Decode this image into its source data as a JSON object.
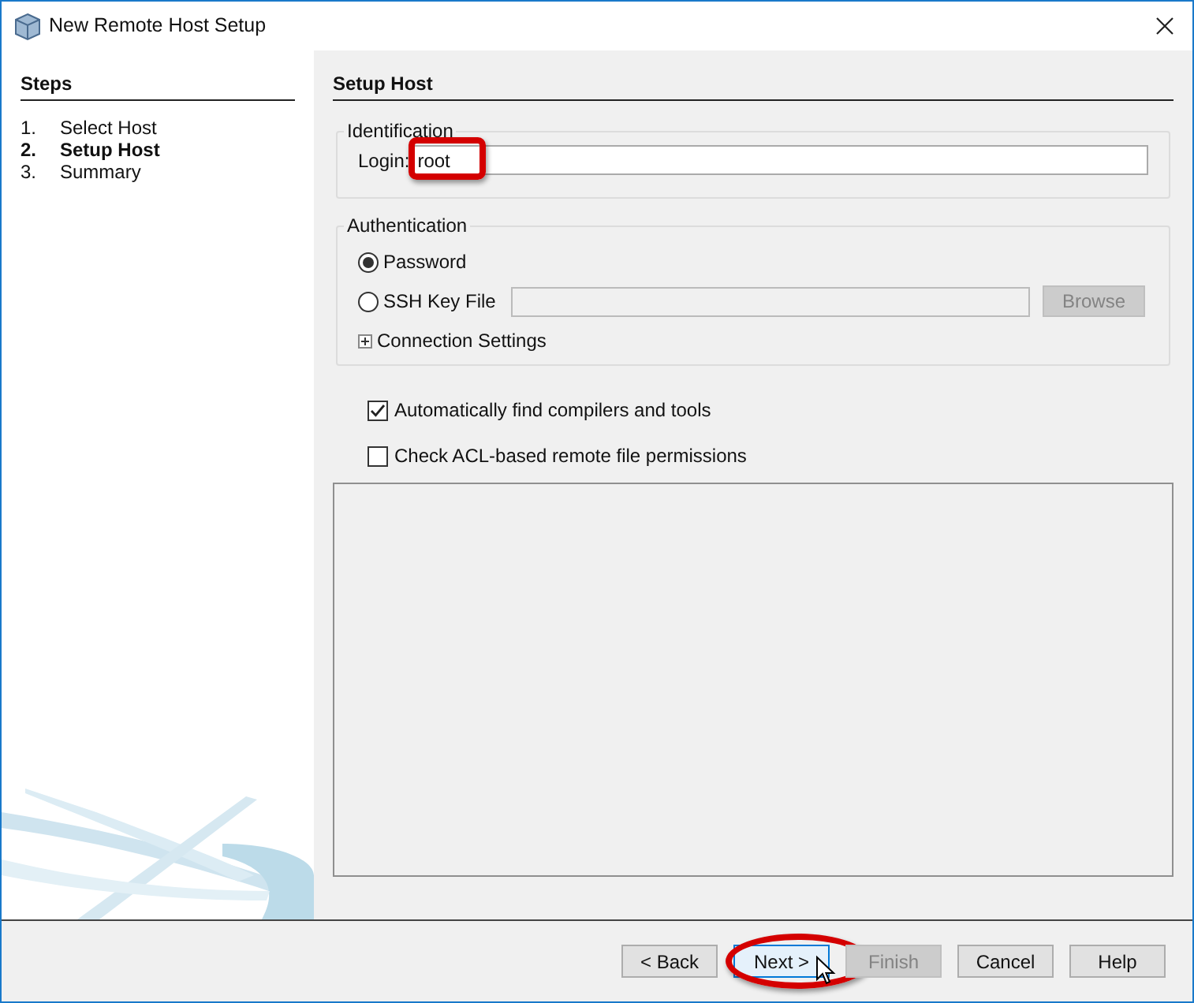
{
  "window": {
    "title": "New Remote Host Setup"
  },
  "steps": {
    "title": "Steps",
    "items": [
      {
        "number": "1.",
        "label": "Select Host",
        "selected": false
      },
      {
        "number": "2.",
        "label": "Setup Host",
        "selected": true
      },
      {
        "number": "3.",
        "label": "Summary",
        "selected": false
      }
    ]
  },
  "panel": {
    "title": "Setup Host"
  },
  "identification": {
    "legend": "Identification",
    "login_label": "Login:",
    "login_value": "root",
    "highlighted": true
  },
  "authentication": {
    "legend": "Authentication",
    "options": [
      {
        "label": "Password",
        "selected": true
      },
      {
        "label": "SSH Key File",
        "selected": false
      }
    ],
    "key_file": {
      "disabled": true
    },
    "browse": {
      "label": "Browse",
      "disabled": true
    },
    "connection_settings": {
      "label": "Connection Settings",
      "expanded": false
    }
  },
  "options": [
    {
      "label": "Automatically find compilers and tools",
      "checked": true
    },
    {
      "label": "Check ACL-based remote file permissions",
      "checked": false
    }
  ],
  "buttons": [
    {
      "label": "< Back",
      "disabled": false,
      "highlighted": false
    },
    {
      "label": "Next >",
      "disabled": false,
      "highlighted": true
    },
    {
      "label": "Finish",
      "disabled": true,
      "highlighted": false
    },
    {
      "label": "Cancel",
      "disabled": false,
      "highlighted": false
    },
    {
      "label": "Help",
      "disabled": false,
      "highlighted": false
    }
  ]
}
